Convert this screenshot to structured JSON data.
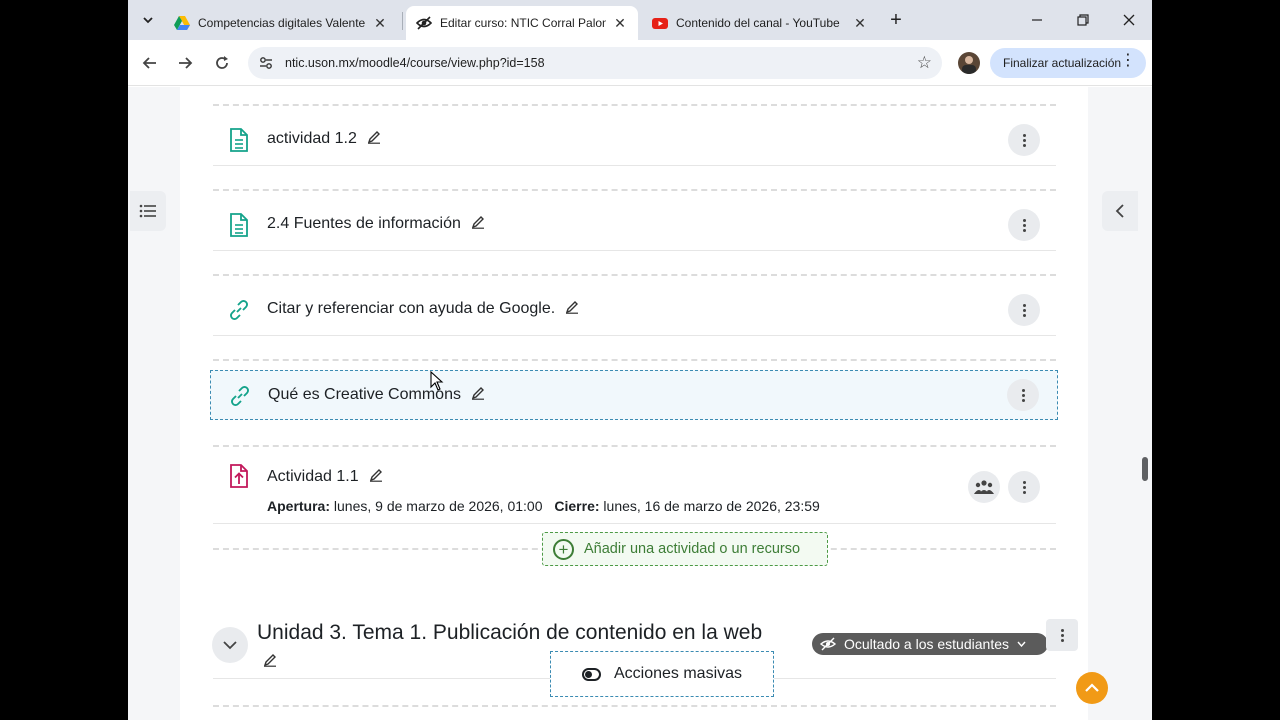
{
  "tabs": [
    {
      "title": "Competencias digitales Valente",
      "favicon": "google-drive-icon"
    },
    {
      "title": "Editar curso: NTIC Corral Palom",
      "favicon": "eye-slash-icon",
      "active": true
    },
    {
      "title": "Contenido del canal - YouTube",
      "favicon": "youtube-icon"
    }
  ],
  "toolbar": {
    "url": "ntic.uson.mx/moodle4/course/view.php?id=158",
    "update_label": "Finalizar actualización"
  },
  "activities": [
    {
      "name": "actividad 1.2",
      "icon": "page-icon"
    },
    {
      "name": "2.4 Fuentes de información",
      "icon": "page-icon"
    },
    {
      "name": "Citar y referenciar con ayuda de Google.",
      "icon": "link-icon"
    },
    {
      "name": "Qué es Creative Commons",
      "icon": "link-icon",
      "selected": true
    },
    {
      "name": "Actividad 1.1",
      "icon": "assignment-icon"
    }
  ],
  "assignment_dates": {
    "open_label": "Apertura:",
    "open_value": "lunes, 9 de marzo de 2026, 01:00",
    "close_label": "Cierre:",
    "close_value": "lunes, 16 de marzo de 2026, 23:59"
  },
  "add_resource_label": "Añadir una actividad o un recurso",
  "section": {
    "title": "Unidad 3. Tema 1. Publicación de contenido en la web",
    "visibility_badge": "Ocultado a los estudiantes"
  },
  "bulk_actions_label": "Acciones masivas",
  "colors": {
    "page_icon": "#14a38b",
    "link_icon": "#14a38b",
    "assign_icon": "#c2185b",
    "add_resource": "#3d7d36",
    "to_top": "#f19a16"
  }
}
